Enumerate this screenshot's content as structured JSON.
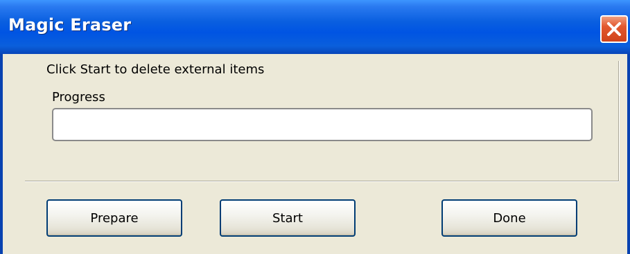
{
  "window": {
    "title": "Magic Eraser",
    "close_icon": "close-x-icon"
  },
  "content": {
    "instruction": "Click Start to delete external items",
    "progress_label": "Progress",
    "progress_value": 0
  },
  "buttons": {
    "prepare": "Prepare",
    "start": "Start",
    "done": "Done"
  },
  "colors": {
    "titlebar": "#0054e3",
    "close_button": "#e2582e",
    "dialog_background": "#ece9d8"
  }
}
